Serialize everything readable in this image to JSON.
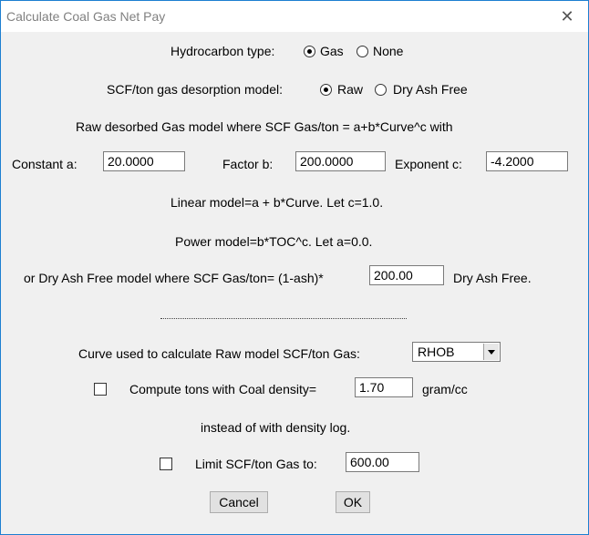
{
  "window": {
    "title": "Calculate Coal Gas Net Pay",
    "close_label": "✕"
  },
  "hydrocarbon": {
    "label": "Hydrocarbon type:",
    "options": [
      {
        "label": "Gas",
        "selected": true
      },
      {
        "label": "None",
        "selected": false
      }
    ]
  },
  "desorption": {
    "label": "SCF/ton gas desorption model:",
    "options": [
      {
        "label": "Raw",
        "selected": true
      },
      {
        "label": "Dry Ash Free",
        "selected": false
      }
    ]
  },
  "raw_model": {
    "heading": "Raw desorbed Gas model where SCF Gas/ton = a+b*Curve^c with",
    "constant_label": "Constant a:",
    "constant_value": "20.0000",
    "factor_label": "Factor b:",
    "factor_value": "200.0000",
    "exponent_label": "Exponent c:",
    "exponent_value": "-4.2000",
    "linear_note": "Linear model=a + b*Curve. Let c=1.0.",
    "power_note": "Power model=b*TOC^c. Let a=0.0."
  },
  "dry_ash": {
    "label": "or Dry Ash Free model where SCF Gas/ton= (1-ash)*",
    "value": "200.00",
    "suffix": "Dry Ash Free."
  },
  "curve": {
    "label": "Curve used to calculate Raw model SCF/ton Gas:",
    "selected": "RHOB"
  },
  "coal_density": {
    "checked": false,
    "label": "Compute tons with Coal density=",
    "value": "1.70",
    "unit": "gram/cc",
    "note": "instead of with density log."
  },
  "limit": {
    "checked": false,
    "label": "Limit SCF/ton Gas to:",
    "value": "600.00"
  },
  "buttons": {
    "cancel": "Cancel",
    "ok": "OK"
  }
}
